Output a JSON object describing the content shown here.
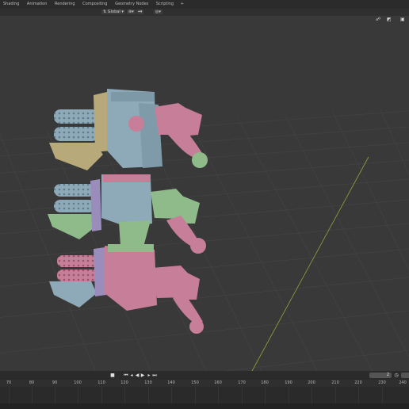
{
  "workspace_tabs": [
    "Shading",
    "Animation",
    "Rendering",
    "Compositing",
    "Geometry Nodes",
    "Scripting",
    "+"
  ],
  "header": {
    "orientation_label": "Global"
  },
  "timeline": {
    "current_frame": "2",
    "ruler_ticks": [
      "70",
      "80",
      "90",
      "100",
      "110",
      "120",
      "130",
      "140",
      "150",
      "160",
      "170",
      "180",
      "190",
      "200",
      "210",
      "220",
      "230",
      "240"
    ]
  },
  "colors": {
    "grey_blue": "#8eaab8",
    "khaki": "#b8a97a",
    "pink": "#c77e98",
    "green": "#8fbb8a",
    "lilac": "#9a8dbb",
    "grid_axis": "#8ea63a"
  },
  "icons": [
    "orientation-icon",
    "pivot-icon",
    "snap-icon",
    "proportional-icon",
    "gizmo-icon",
    "overlay-icon",
    "xray-icon",
    "play-icon",
    "jump-start-icon",
    "step-back-icon",
    "reverse-play-icon",
    "play-forward-icon",
    "step-forward-icon",
    "jump-end-icon",
    "stopwatch-icon"
  ]
}
